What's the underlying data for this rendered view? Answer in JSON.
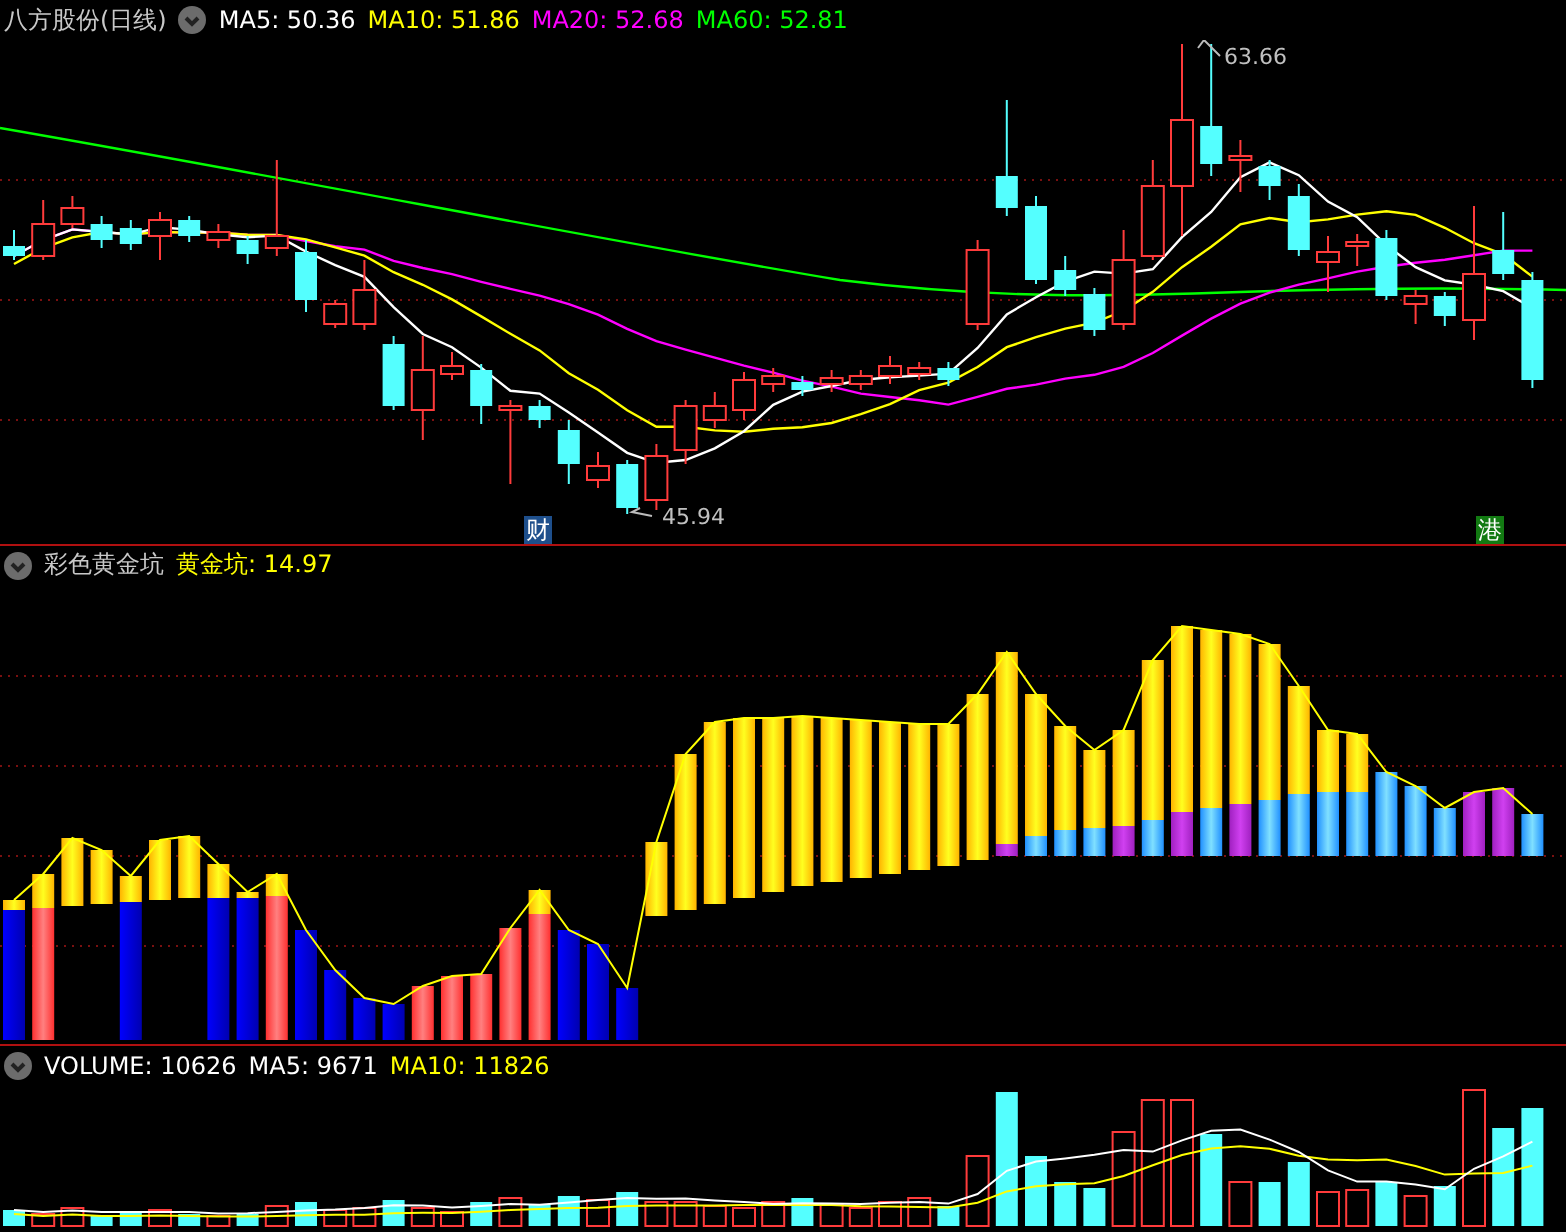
{
  "title": "八方股份(日线)",
  "main_indicators": [
    {
      "label": "MA5: 50.36",
      "color": "#ffffff"
    },
    {
      "label": "MA10: 51.86",
      "color": "#ffff00"
    },
    {
      "label": "MA20: 52.68",
      "color": "#ff00ff"
    },
    {
      "label": "MA60: 52.81",
      "color": "#00ff00"
    }
  ],
  "price_labels": {
    "high": "63.66",
    "low": "45.94"
  },
  "markers": [
    {
      "text": "财",
      "color": "#1e4f8c"
    },
    {
      "text": "港",
      "color": "#127a12"
    }
  ],
  "indicator_panel": {
    "name": "彩色黄金坑",
    "values": [
      {
        "label": "黄金坑: 14.97",
        "color": "#ffff00"
      }
    ]
  },
  "volume_panel": {
    "values": [
      {
        "label": "VOLUME: 10626",
        "color": "#ffffff"
      },
      {
        "label": "MA5: 9671",
        "color": "#ffffff"
      },
      {
        "label": "MA10: 11826",
        "color": "#ffff00"
      }
    ]
  }
}
